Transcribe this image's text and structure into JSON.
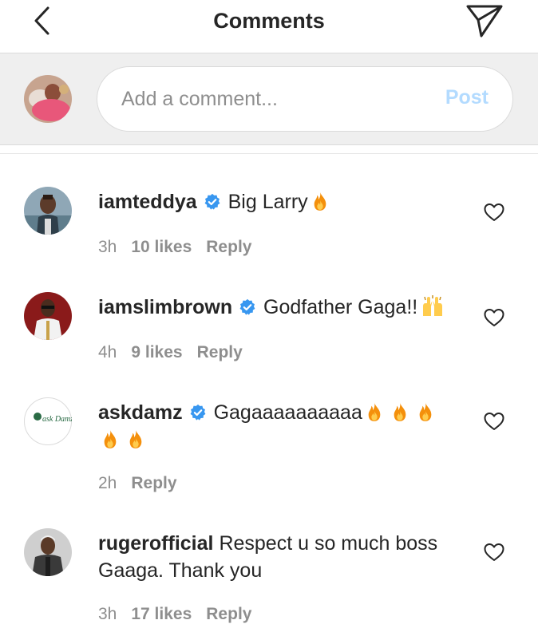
{
  "header": {
    "title": "Comments",
    "back_icon": "back-chevron-icon",
    "send_icon": "paper-plane-icon"
  },
  "composer": {
    "placeholder": "Add a comment...",
    "post_label": "Post",
    "post_color": "#b3dbff"
  },
  "comments": [
    {
      "username": "iamteddya",
      "verified": true,
      "text": "Big Larry",
      "emojis": [
        "fire"
      ],
      "time": "3h",
      "likes": "10 likes",
      "reply": "Reply"
    },
    {
      "username": "iamslimbrown",
      "verified": true,
      "text": "Godfather Gaga!!",
      "emojis": [
        "raised-hands"
      ],
      "time": "4h",
      "likes": "9 likes",
      "reply": "Reply"
    },
    {
      "username": "askdamz",
      "verified": true,
      "text": "Gagaaaaaaaaaa",
      "emojis": [
        "fire",
        "fire",
        "fire",
        "fire",
        "fire"
      ],
      "time": "2h",
      "likes": "",
      "reply": "Reply",
      "avatar_text": "ask Damz"
    },
    {
      "username": "rugerofficial",
      "verified": false,
      "text": "Respect u so much boss Gaaga. Thank you",
      "emojis": [],
      "time": "3h",
      "likes": "17 likes",
      "reply": "Reply"
    }
  ],
  "colors": {
    "verified": "#3897f0",
    "secondary_text": "#8e8e8e",
    "composer_bg": "#efefef"
  }
}
